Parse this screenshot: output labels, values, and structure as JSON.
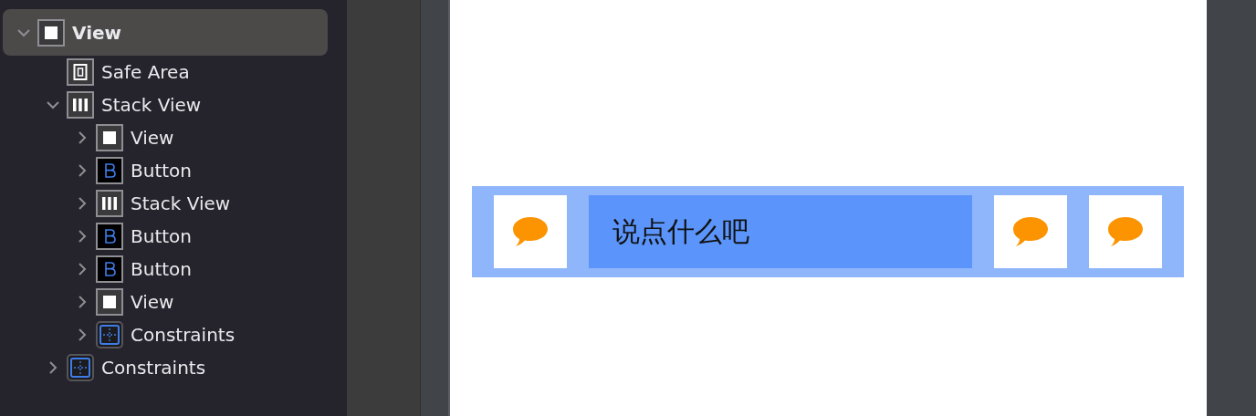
{
  "outline": [
    {
      "kind": "view",
      "label": "View",
      "selected": true,
      "expanded": true,
      "children": [
        {
          "kind": "safe-area",
          "label": "Safe Area",
          "selected": false
        },
        {
          "kind": "stack",
          "label": "Stack View",
          "selected": false,
          "expanded": true,
          "children": [
            {
              "kind": "view",
              "label": "View",
              "selected": false,
              "expanded": false
            },
            {
              "kind": "button",
              "label": "Button",
              "selected": false,
              "expanded": false
            },
            {
              "kind": "stack",
              "label": "Stack View",
              "selected": false,
              "expanded": false
            },
            {
              "kind": "button",
              "label": "Button",
              "selected": false,
              "expanded": false
            },
            {
              "kind": "button",
              "label": "Button",
              "selected": false,
              "expanded": false
            },
            {
              "kind": "view",
              "label": "View",
              "selected": false,
              "expanded": false
            },
            {
              "kind": "constraints",
              "label": "Constraints",
              "selected": false,
              "expanded": false
            }
          ]
        },
        {
          "kind": "constraints",
          "label": "Constraints",
          "selected": false,
          "expanded": false
        }
      ]
    }
  ],
  "stack_bar": [
    {
      "kind": "chat-tile"
    },
    {
      "kind": "label",
      "text": "说点什么吧"
    },
    {
      "kind": "chat-tile"
    },
    {
      "kind": "chat-tile"
    }
  ]
}
